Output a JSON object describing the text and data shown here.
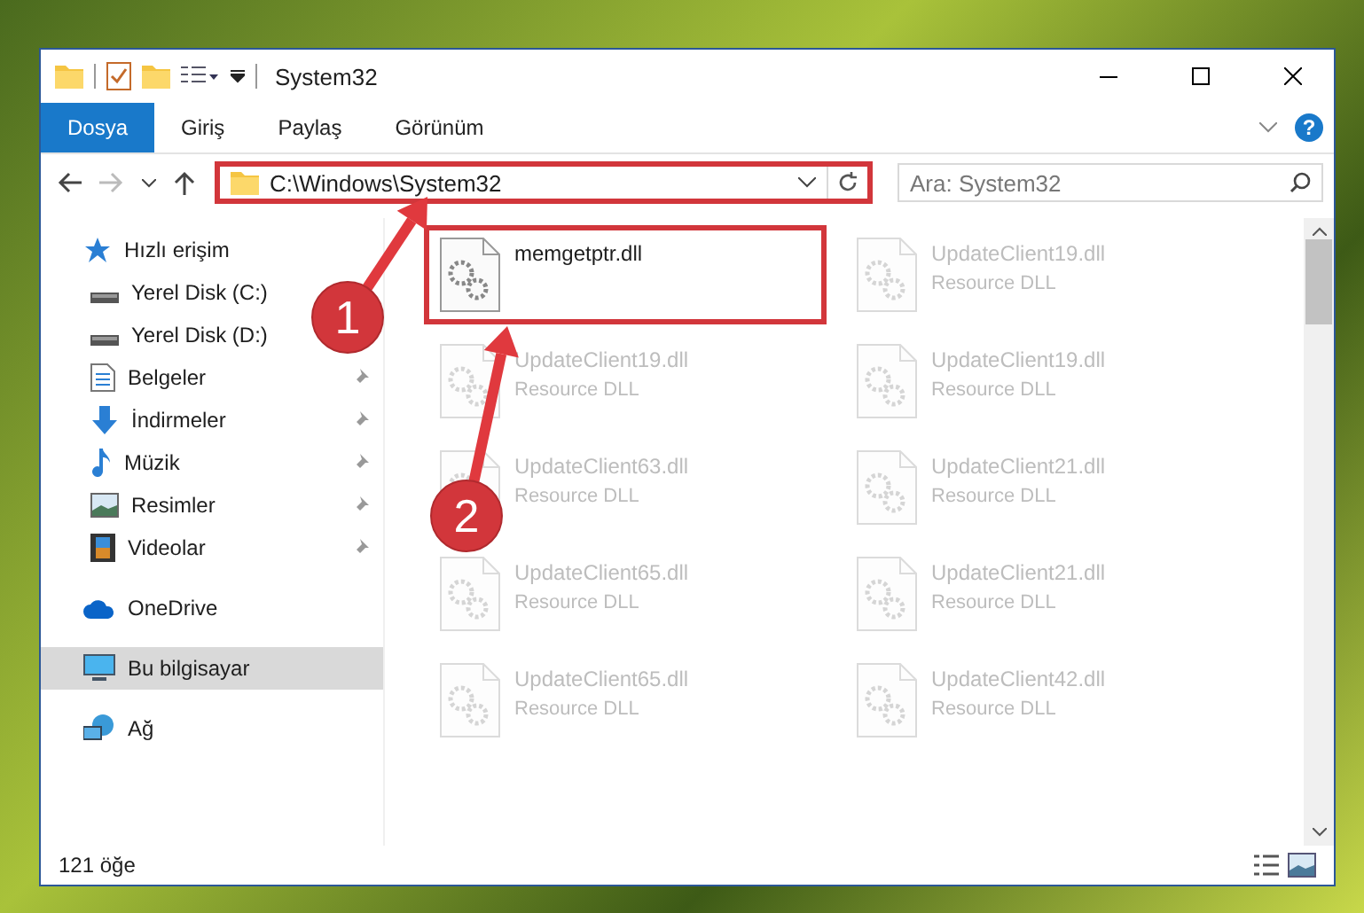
{
  "window": {
    "title": "System32"
  },
  "ribbon_tabs": [
    {
      "label": "Dosya",
      "selected": true
    },
    {
      "label": "Giriş",
      "selected": false
    },
    {
      "label": "Paylaş",
      "selected": false
    },
    {
      "label": "Görünüm",
      "selected": false
    }
  ],
  "help": "?",
  "address": {
    "value": "C:\\Windows\\System32",
    "highlighted": true
  },
  "search": {
    "placeholder": "Ara: System32"
  },
  "sidebar": {
    "items": [
      {
        "label": "Hızlı erişim",
        "kind": "star",
        "selected": false,
        "pinned": false,
        "children": [
          {
            "label": "Yerel Disk (C:)",
            "kind": "disk",
            "selected": false,
            "pinned": false
          },
          {
            "label": "Yerel Disk (D:)",
            "kind": "disk",
            "selected": false,
            "pinned": false
          },
          {
            "label": "Belgeler",
            "kind": "document",
            "selected": false,
            "pinned": true
          },
          {
            "label": "İndirmeler",
            "kind": "download",
            "selected": false,
            "pinned": true
          },
          {
            "label": "Müzik",
            "kind": "music",
            "selected": false,
            "pinned": true
          },
          {
            "label": "Resimler",
            "kind": "picture",
            "selected": false,
            "pinned": true
          },
          {
            "label": "Videolar",
            "kind": "video",
            "selected": false,
            "pinned": true
          }
        ]
      },
      {
        "label": "OneDrive",
        "kind": "cloud",
        "selected": false,
        "pinned": false
      },
      {
        "label": "Bu bilgisayar",
        "kind": "computer",
        "selected": true,
        "pinned": false
      },
      {
        "label": "Ağ",
        "kind": "network",
        "selected": false,
        "pinned": false
      }
    ]
  },
  "files": [
    {
      "name": "memgetptr.dll",
      "highlighted": true,
      "blurred": false
    },
    {
      "name": "UpdateClient19.dll",
      "type": "Resource DLL",
      "highlighted": false,
      "blurred": true
    },
    {
      "name": "UpdateClient19.dll",
      "type": "Resource DLL",
      "highlighted": false,
      "blurred": true
    },
    {
      "name": "UpdateClient19.dll",
      "type": "Resource DLL",
      "highlighted": false,
      "blurred": true
    },
    {
      "name": "UpdateClient63.dll",
      "type": "Resource DLL",
      "highlighted": false,
      "blurred": true
    },
    {
      "name": "UpdateClient21.dll",
      "type": "Resource DLL",
      "highlighted": false,
      "blurred": true
    },
    {
      "name": "UpdateClient65.dll",
      "type": "Resource DLL",
      "highlighted": false,
      "blurred": true
    },
    {
      "name": "UpdateClient21.dll",
      "type": "Resource DLL",
      "highlighted": false,
      "blurred": true
    },
    {
      "name": "UpdateClient65.dll",
      "type": "Resource DLL",
      "highlighted": false,
      "blurred": true
    },
    {
      "name": "UpdateClient42.dll",
      "type": "Resource DLL",
      "highlighted": false,
      "blurred": true
    }
  ],
  "status_bar": {
    "count": "121 öğe"
  },
  "callouts": [
    {
      "number": "1"
    },
    {
      "number": "2"
    }
  ]
}
